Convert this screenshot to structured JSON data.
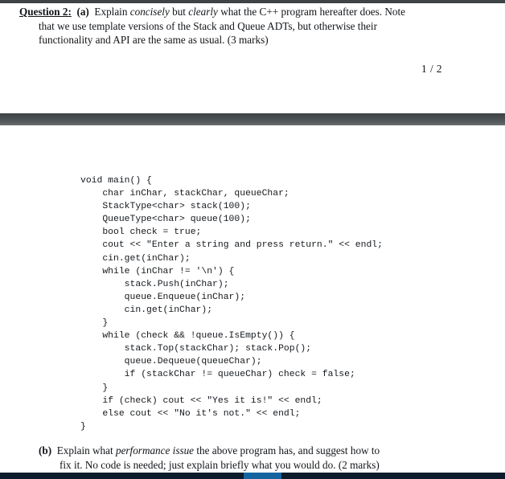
{
  "bars": {
    "top_color": "#3b4042",
    "mid_color": "#4b5053",
    "bottom_color": "#0c1c2c",
    "bottom_highlight_color": "#1464a0"
  },
  "question_a": {
    "label": "Question 2:",
    "part": "(a)",
    "line1_pre": "Explain ",
    "line1_italic1": "concisely",
    "line1_mid": " but ",
    "line1_italic2": "clearly",
    "line1_post": " what the C++ program hereafter does. Note",
    "line2": "that we use template versions of the Stack and Queue ADTs, but otherwise their",
    "line3": "functionality and API are the same as usual.  (3 marks)"
  },
  "page_indicator": "1 / 2",
  "code": {
    "lines": [
      "void main() {",
      "    char inChar, stackChar, queueChar;",
      "    StackType<char> stack(100);",
      "    QueueType<char> queue(100);",
      "    bool check = true;",
      "    cout << \"Enter a string and press return.\" << endl;",
      "    cin.get(inChar);",
      "    while (inChar != '\\n') {",
      "        stack.Push(inChar);",
      "        queue.Enqueue(inChar);",
      "        cin.get(inChar);",
      "    }",
      "    while (check && !queue.IsEmpty()) {",
      "        stack.Top(stackChar); stack.Pop();",
      "        queue.Dequeue(queueChar);",
      "        if (stackChar != queueChar) check = false;",
      "    }",
      "    if (check) cout << \"Yes it is!\" << endl;",
      "    else cout << \"No it's not.\" << endl;",
      "}"
    ]
  },
  "question_b": {
    "label": "(b)",
    "line1_pre": "Explain what ",
    "line1_italic": "performance issue",
    "line1_post": " the above program has, and suggest how to",
    "line2": "fix it. No code is needed; just explain briefly what you would do.  (2 marks)"
  }
}
